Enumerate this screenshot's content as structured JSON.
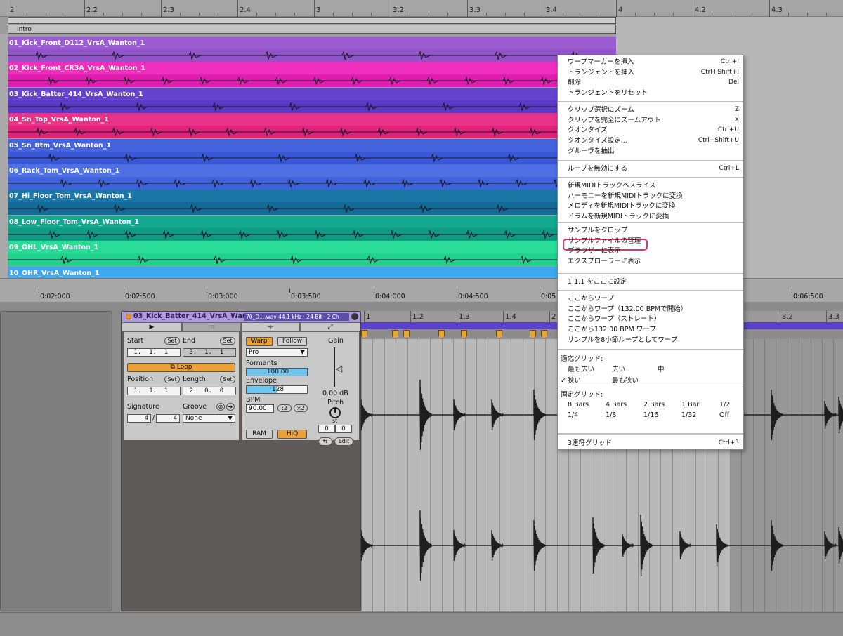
{
  "arrangement": {
    "ruler_labels": [
      "2",
      "2.2",
      "2.3",
      "2.4",
      "3",
      "3.2",
      "3.3",
      "3.4",
      "4",
      "4.2",
      "4.3"
    ],
    "locator": "Intro",
    "tracks": [
      {
        "name": "01_Kick_Front_D112_VrsA_Wanton_1",
        "color": "#9153c7",
        "title_color": "#9b5dd1"
      },
      {
        "name": "02_Kick_Front_CR3A_VrsA_Wanton_1",
        "color": "#e11cb0",
        "title_color": "#ee2fbe"
      },
      {
        "name": "03_Kick_Batter_414_VrsA_Wanton_1",
        "color": "#5a39c7",
        "title_color": "#6543cf"
      },
      {
        "name": "04_Sn_Top_VrsA_Wanton_1",
        "color": "#e0237b",
        "title_color": "#e93389"
      },
      {
        "name": "05_Sn_Btm_VrsA_Wanton_1",
        "color": "#3a58d6",
        "title_color": "#4663de"
      },
      {
        "name": "06_Rack_Tom_VrsA_Wanton_1",
        "color": "#3f63da",
        "title_color": "#4e70e2"
      },
      {
        "name": "07_Hi_Floor_Tom_VrsA_Wanton_1",
        "color": "#126a96",
        "title_color": "#1a77a5"
      },
      {
        "name": "08_Low_Floor_Tom_VrsA_Wanton_1",
        "color": "#0f9a84",
        "title_color": "#13a78f"
      },
      {
        "name": "09_OHL_VrsA_Wanton_1",
        "color": "#1fd38d",
        "title_color": "#2adc97"
      },
      {
        "name": "10_OHR_VrsA_Wanton_1",
        "color": "#2f9ae3",
        "title_color": "#3ea7ee"
      }
    ],
    "time_labels": [
      "0:02:000",
      "0:02:500",
      "0:03:000",
      "0:03:500",
      "0:04:000",
      "0:04:500",
      "0:05",
      "0:06:500"
    ]
  },
  "clip": {
    "title": "03_Kick_Batter_414_VrsA_Wan",
    "file_info": "70_D....wav   44.1 kHz · 24-Bit · 2 Ch",
    "start_label": "Start",
    "end_label": "End",
    "set": "Set",
    "start_value": " 1.  1.  1",
    "end_value": " 3.  1.  1",
    "loop": "Loop",
    "position_label": "Position",
    "length_label": "Length",
    "position_value": " 1.  1.  1",
    "length_value": " 2.  0.  0",
    "signature_label": "Signature",
    "groove_label": "Groove",
    "sig_num": "4",
    "sig_den": "4",
    "groove_value": "None",
    "warp": "Warp",
    "follow": "Follow",
    "mode": "Pro",
    "formants_label": "Formants",
    "formants_value": "100.00",
    "envelope_label": "Envelope",
    "envelope_value": "128",
    "bpm_label": "BPM",
    "bpm_value": "90.00",
    "half": ":2",
    "double": "×2",
    "ram": "RAM",
    "hiq": "HiQ",
    "gain_label": "Gain",
    "gain_value": "0.00 dB",
    "pitch_label": "Pitch",
    "st": "st",
    "pitch_value": "0",
    "cents_value": "0",
    "edit": "Edit"
  },
  "sample_ruler": [
    "1",
    "1.2",
    "1.3",
    "1.4",
    "2",
    "3.2",
    "3.3"
  ],
  "context_menu": {
    "groups": [
      [
        {
          "label": "ワープマーカーを挿入",
          "shortcut": "Ctrl+I"
        },
        {
          "label": "トランジェントを挿入",
          "shortcut": "Ctrl+Shift+I"
        },
        {
          "label": "削除",
          "shortcut": "Del"
        },
        {
          "label": "トランジェントをリセット",
          "shortcut": ""
        }
      ],
      [
        {
          "label": "クリップ選択にズーム",
          "shortcut": "Z"
        },
        {
          "label": "クリップを完全にズームアウト",
          "shortcut": "X"
        },
        {
          "label": "クオンタイズ",
          "shortcut": "Ctrl+U"
        },
        {
          "label": "クオンタイズ設定...",
          "shortcut": "Ctrl+Shift+U"
        },
        {
          "label": "グルーヴを抽出",
          "shortcut": ""
        }
      ],
      [
        {
          "label": "ループを無効にする",
          "shortcut": "Ctrl+L"
        }
      ],
      [
        {
          "label": "新規MIDIトラックへスライス",
          "shortcut": ""
        },
        {
          "label": "ハーモニーを新規MIDIトラックに変換",
          "shortcut": ""
        },
        {
          "label": "メロディを新規MIDIトラックに変換",
          "shortcut": ""
        },
        {
          "label": "ドラムを新規MIDIトラックに変換",
          "shortcut": ""
        }
      ],
      [
        {
          "label": "サンプルをクロップ",
          "shortcut": ""
        },
        {
          "label": "サンプルファイルの管理",
          "shortcut": ""
        },
        {
          "label": "ブラウザーに表示",
          "shortcut": ""
        },
        {
          "label": "エクスプローラーに表示",
          "shortcut": ""
        }
      ],
      [
        {
          "label": "1.1.1 をここに設定",
          "shortcut": ""
        }
      ],
      [
        {
          "label": "ここからワープ",
          "shortcut": ""
        },
        {
          "label": "ここからワープ（132.00 BPMで開始）",
          "shortcut": ""
        },
        {
          "label": "ここからワープ（ストレート）",
          "shortcut": ""
        },
        {
          "label": "ここから132.00 BPM ワープ",
          "shortcut": ""
        },
        {
          "label": "サンプルを8小節ループとしてワープ",
          "shortcut": ""
        }
      ]
    ],
    "adaptive_grid_title": "適応グリッド:",
    "adaptive_grid": [
      "最も広い",
      "広い",
      "中",
      "狭い",
      "最も狭い"
    ],
    "adaptive_checked": "✓",
    "fixed_grid_title": "固定グリッド:",
    "fixed_grid": [
      "8 Bars",
      "4 Bars",
      "2 Bars",
      "1 Bar",
      "1/2",
      "1/4",
      "1/8",
      "1/16",
      "1/32",
      "Off"
    ],
    "triplet": {
      "label": "3連符グリッド",
      "shortcut": "Ctrl+3"
    },
    "highlight_color": "#e6306b"
  }
}
